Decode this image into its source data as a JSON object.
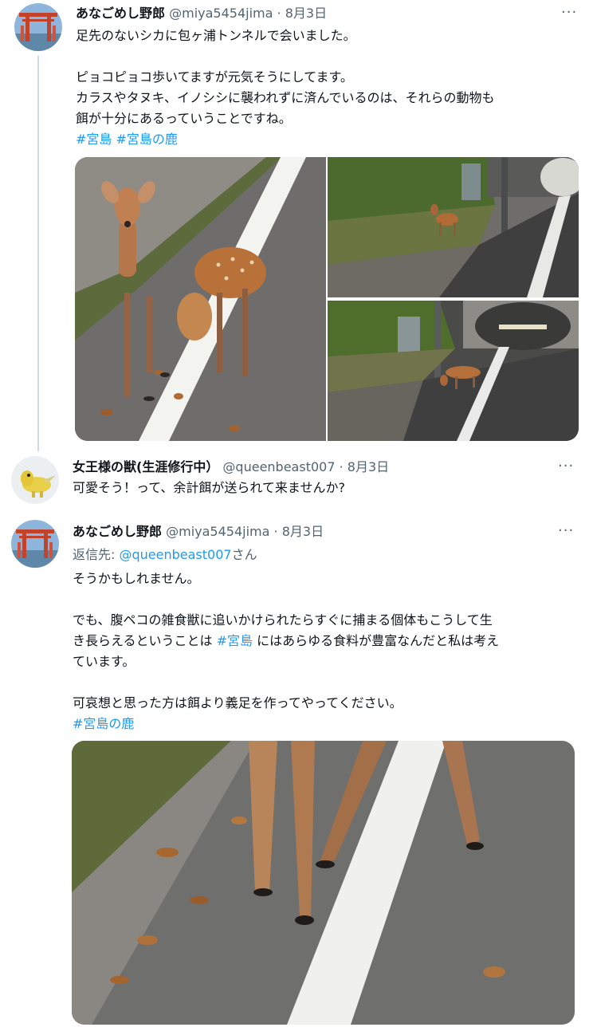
{
  "tweets": [
    {
      "name": "あなごめし野郎",
      "handle": "@miya5454jima",
      "sep": "·",
      "date": "8月3日",
      "more": "···",
      "lines": [
        "足先のないシカに包ヶ浦トンネルで会いました。",
        "ピョコピョコ歩いてますが元気そうにしてます。",
        "カラスやタヌキ、イノシシに襲われずに済んでいるのは、それらの動物も",
        "餌が十分にあるっていうことですね。"
      ],
      "hashtags": [
        "#宮島",
        "#宮島の鹿"
      ]
    },
    {
      "name": "女王様の獣(生涯修行中）",
      "handle": "@queenbeast007",
      "sep": "·",
      "date": "8月3日",
      "more": "···",
      "lines": [
        "可愛そう！って、余計餌が送られて来ませんか?"
      ]
    },
    {
      "name": "あなごめし野郎",
      "handle": "@miya5454jima",
      "sep": "·",
      "date": "8月3日",
      "more": "···",
      "reply_prefix": "返信先: ",
      "reply_handle": "@queenbeast007",
      "reply_suffix": "さん",
      "lines": [
        "そうかもしれません。",
        "でも、腹ペコの雑食獣に追いかけられたらすぐに捕まる個体もこうして生",
        "き長らえるということは ",
        "#宮島",
        " にはあらゆる食料が豊富なんだと私は考え",
        "ています。",
        "可哀想と思った方は餌より義足を作ってやってください。"
      ],
      "hashtags": [
        "#宮島の鹿"
      ]
    }
  ],
  "colors": {
    "link": "#1d9bf0",
    "secondary_text": "#536471",
    "thread_line": "#cfd9de"
  }
}
